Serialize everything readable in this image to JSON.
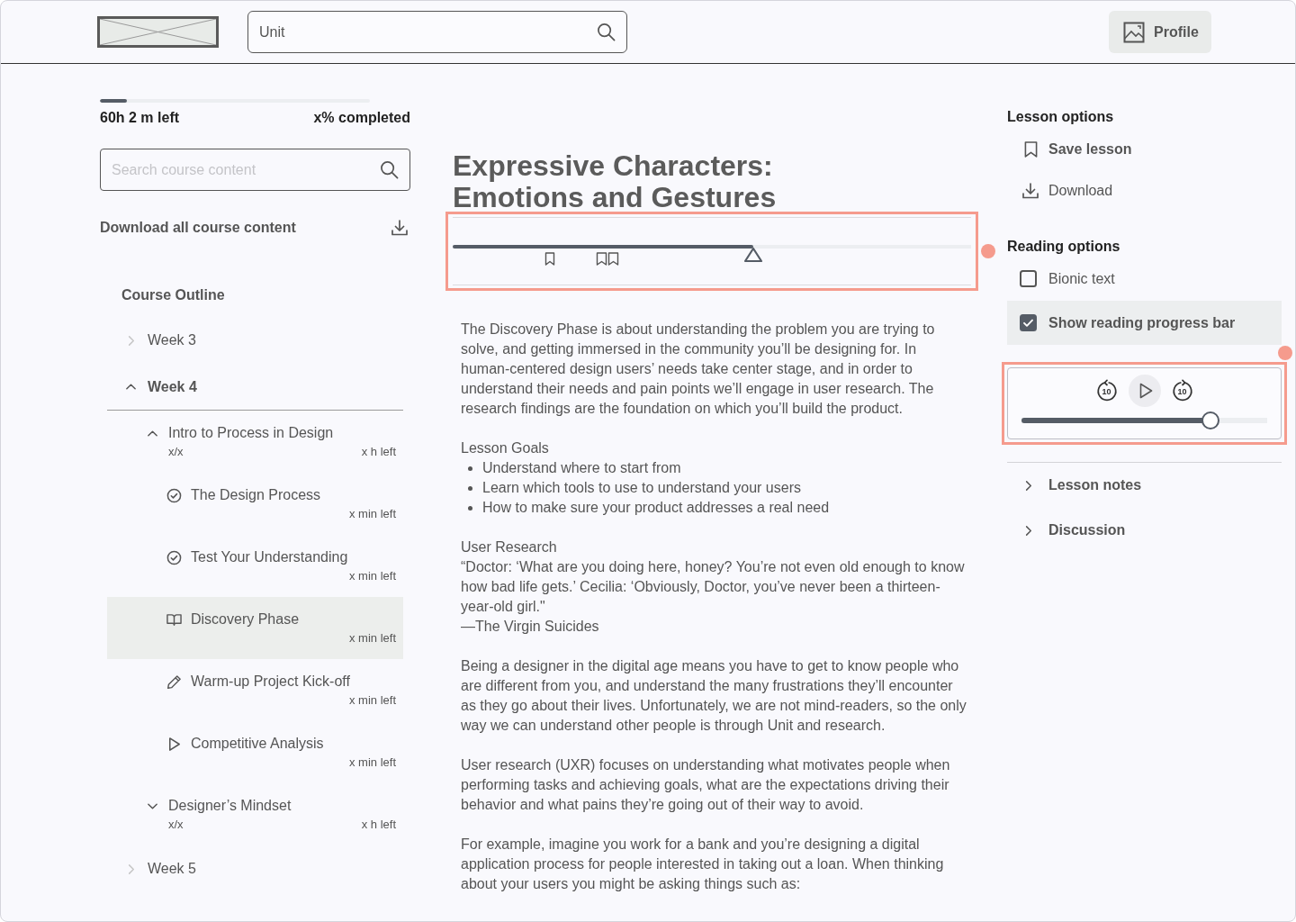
{
  "header": {
    "search": {
      "value": "Unit"
    },
    "profile_button": {
      "label": "Profile"
    }
  },
  "sidebar": {
    "progress": {
      "level": 0.1,
      "time_left": "60h 2 m left",
      "completed": "x% completed"
    },
    "search": {
      "placeholder": "Search course content"
    },
    "download_all": {
      "label": "Download all course content"
    },
    "outline": {
      "title": "Course Outline",
      "children": [
        {
          "label": "Week 3",
          "expanded": false
        },
        {
          "label": "Week 4",
          "expanded": true,
          "children": [
            {
              "title": "Intro to Process in Design",
              "expanded": true,
              "progress": "x/x",
              "time_left": "x h left",
              "children": [
                {
                  "kind": "completed",
                  "title": "The Design Process",
                  "time_left": "x min left",
                  "selected": false
                },
                {
                  "kind": "completed",
                  "title": "Test Your Understanding",
                  "time_left": "x min left",
                  "selected": false
                },
                {
                  "kind": "reading",
                  "title": "Discovery Phase",
                  "time_left": "x min left",
                  "selected": true
                },
                {
                  "kind": "assignment",
                  "title": "Warm-up Project Kick-off",
                  "time_left": "x min left",
                  "selected": false
                },
                {
                  "kind": "video",
                  "title": "Competitive Analysis",
                  "time_left": "x min left",
                  "selected": false
                }
              ]
            },
            {
              "title": "Designer’s Mindset",
              "expanded": false,
              "progress": "x/x",
              "time_left": "x h left"
            }
          ]
        },
        {
          "label": "Week 5",
          "expanded": false
        }
      ]
    }
  },
  "main": {
    "title": "Expressive Characters: Emotions and Gestures",
    "reading_progress": {
      "level": 0.58,
      "annotated": true
    },
    "body": [
      {
        "kind": "paragraph",
        "text": "The Discovery Phase is about understanding the problem you are trying to solve, and getting immersed in the community you’ll be designing for. In human-centered design users’ needs take center stage, and in order to understand their needs and pain points we’ll engage in user research. The research findings are the foundation on which you’ll build the product."
      },
      {
        "kind": "list",
        "heading": "Lesson Goals",
        "items": [
          "Understand where to start from",
          "Learn which tools to use to understand your users",
          "How to make sure your product addresses a real need"
        ]
      },
      {
        "kind": "quote",
        "heading": "User Research",
        "text": "“Doctor: ‘What are you doing here, honey? You’re not even old enough to know how bad life gets.’ Cecilia: ‘Obviously, Doctor, you’ve never been a thirteen-year-old girl.\"",
        "source": "—The Virgin Suicides"
      },
      {
        "kind": "paragraph",
        "text": "Being a designer in the digital age means you have to get to know people who are different from you, and understand the many frustrations they’ll encounter as they go about their lives. Unfortunately, we are not mind-readers, so the only way we can understand other people is through Unit and research."
      },
      {
        "kind": "paragraph",
        "text": "User research (UXR) focuses on understanding what motivates people when performing tasks and achieving goals, what are the expectations driving their behavior and what pains they’re going out of their way to avoid."
      },
      {
        "kind": "paragraph",
        "text": "For example, imagine you work for a bank and you’re designing a digital application process for people interested in taking out a loan. When thinking about your users you might be asking things such as:"
      }
    ]
  },
  "right_panel": {
    "lesson_options": {
      "title": "Lesson options",
      "items": [
        {
          "kind": "save",
          "label": "Save lesson"
        },
        {
          "kind": "download",
          "label": "Download"
        }
      ]
    },
    "reading_options": {
      "title": "Reading options",
      "items": [
        {
          "label": "Bionic text",
          "checked": false,
          "hovered": false
        },
        {
          "label": "Show reading progress bar",
          "checked": true,
          "hovered": true
        }
      ]
    },
    "audio_player": {
      "level": 0.77,
      "annotated": true,
      "rewind_label": "10",
      "forward_label": "10"
    },
    "sections": [
      {
        "label": "Lesson notes",
        "expanded": false
      },
      {
        "label": "Discussion",
        "expanded": false
      }
    ]
  }
}
